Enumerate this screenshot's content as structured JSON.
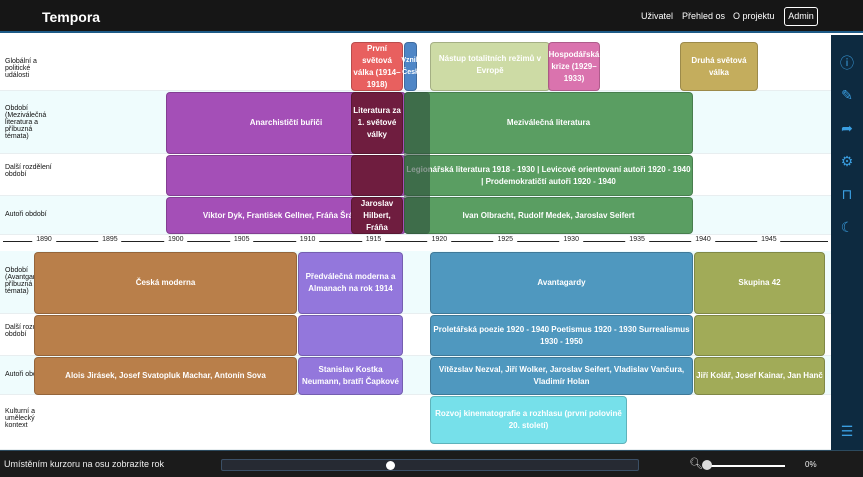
{
  "header": {
    "title": "Tempora",
    "nav": [
      "Uživatel",
      "Přehled os",
      "O projektu"
    ],
    "admin": "Admin"
  },
  "top_rows": [
    "Globální a politické události",
    "Období (Meziválečná literatura a příbuzná témata)",
    "Další rozdělení období",
    "Autoři období"
  ],
  "bottom_rows": [
    "Období (Avantgarda a příbuzná témata)",
    "Další rozdělení období",
    "Autoři období",
    "Kulturní a umělecký kontext"
  ],
  "axis_years": [
    "1890",
    "1895",
    "1900",
    "1905",
    "1910",
    "1915",
    "1920",
    "1925",
    "1930",
    "1935",
    "1940",
    "1945"
  ],
  "events": {
    "ww1": "První světová válka (1914–1918)",
    "vznik": "Vznik Česk",
    "totalitni": "Nástup totalitních režimů v Evropě",
    "krize": "Hospodářská krize (1929–1933)",
    "ww2": "Druhá světová válka"
  },
  "top_boxes": {
    "anarchiste": "Anarchističtí buřiči",
    "anarch_authors": "Viktor Dyk, František Gellner, Fráňa Šrámek",
    "litwar": "Literatura za 1. světové války",
    "litwar_authors": "Jaroslav Hilbert, Fráňa",
    "mezi": "Meziválečná literatura",
    "mezi_sub": "Legionářská literatura 1918 - 1930 | Levicově orientovaní autoři 1920 - 1940 | Prodemokratičtí autoři 1920 - 1940",
    "mezi_authors": "Ivan Olbracht, Rudolf Medek, Jaroslav Seifert"
  },
  "bottom_boxes": {
    "moderna": "Česká moderna",
    "moderna_authors": "Alois Jirásek, Josef Svatopluk Machar, Antonín Sova",
    "predval": "Předválečná moderna a Almanach na rok 1914",
    "predval_authors": "Stanislav Kostka Neumann, bratři Čapkové",
    "avant": "Avantagardy",
    "avant_sub": "Proletářská poezie 1920 - 1940 Poetismus 1920 - 1930 Surrealismus 1930 - 1950",
    "avant_authors": "Vítězslav Nezval, Jiří Wolker, Jaroslav Seifert, Vladislav Vančura, Vladimír Holan",
    "sk42": "Skupina 42",
    "sk42_authors": "Jiří Kolář, Josef Kainar, Jan Hanč",
    "kino": "Rozvoj kinematografie a rozhlasu (první polovině 20. století)"
  },
  "sidebar_icons": [
    "info-icon",
    "edit-icon",
    "share-icon",
    "settings-icon",
    "bookmark-icon",
    "moon-icon",
    "list-icon"
  ],
  "footer": {
    "hint": "Umístěním kurzoru na osu zobrazíte rok",
    "zoom": "0%"
  },
  "timeline_slider": {
    "position": 0.4
  },
  "colors": {
    "accent": "#3a9ee0",
    "sidebar": "#0d2a40"
  }
}
